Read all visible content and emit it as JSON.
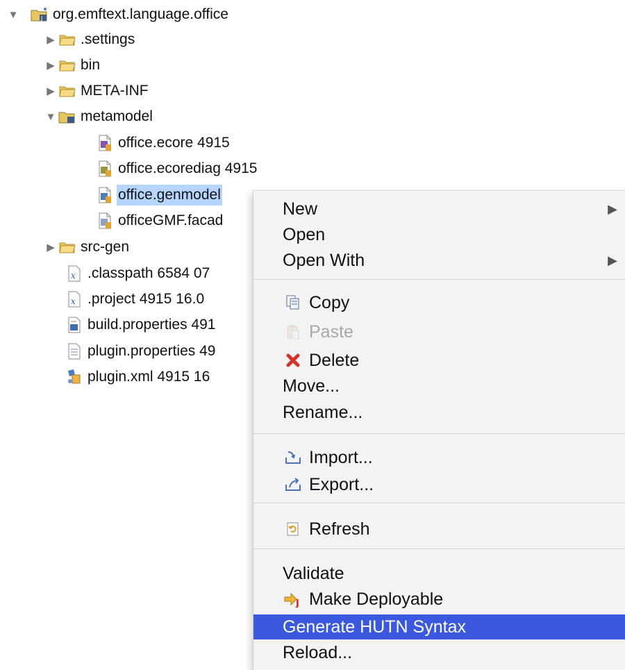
{
  "tree": {
    "root": {
      "label": "org.emftext.language.office",
      "expanded": true,
      "icon": "project-icon"
    },
    "items": [
      {
        "label": ".settings",
        "icon": "folder-icon",
        "expandable": true,
        "expanded": false
      },
      {
        "label": "bin",
        "icon": "folder-icon",
        "expandable": true,
        "expanded": false
      },
      {
        "label": "META-INF",
        "icon": "folder-icon",
        "expandable": true,
        "expanded": false
      },
      {
        "label": "metamodel",
        "icon": "source-folder-icon",
        "expandable": true,
        "expanded": true
      },
      {
        "label": "office.ecore 4915",
        "icon": "ecore-file-icon"
      },
      {
        "label": "office.ecorediag 4915",
        "icon": "ecorediag-file-icon"
      },
      {
        "label": "office.genmodel",
        "icon": "genmodel-file-icon",
        "selected": true
      },
      {
        "label": "officeGMF.facad",
        "icon": "file-icon"
      },
      {
        "label": "src-gen",
        "icon": "folder-icon",
        "expandable": true,
        "expanded": false
      },
      {
        "label": ".classpath 6584  07",
        "icon": "xml-file-icon"
      },
      {
        "label": ".project 4915  16.0",
        "icon": "xml-file-icon"
      },
      {
        "label": "build.properties 491",
        "icon": "properties-file-icon"
      },
      {
        "label": "plugin.properties 49",
        "icon": "text-file-icon"
      },
      {
        "label": "plugin.xml 4915  16",
        "icon": "plugin-xml-icon"
      }
    ]
  },
  "context_menu": {
    "items": [
      {
        "label": "New",
        "submenu": true
      },
      {
        "label": "Open"
      },
      {
        "label": "Open With",
        "submenu": true
      },
      {
        "separator": true
      },
      {
        "label": "Copy",
        "icon": "copy-icon"
      },
      {
        "label": "Paste",
        "icon": "paste-icon",
        "disabled": true
      },
      {
        "label": "Delete",
        "icon": "delete-icon"
      },
      {
        "label": "Move..."
      },
      {
        "label": "Rename..."
      },
      {
        "separator": true
      },
      {
        "label": "Import...",
        "icon": "import-icon"
      },
      {
        "label": "Export...",
        "icon": "export-icon"
      },
      {
        "separator": true
      },
      {
        "label": "Refresh",
        "icon": "refresh-icon"
      },
      {
        "separator": true
      },
      {
        "label": "Validate"
      },
      {
        "label": "Make Deployable",
        "icon": "deploy-icon"
      },
      {
        "label": "Generate HUTN Syntax",
        "highlighted": true
      },
      {
        "label": "Reload..."
      }
    ],
    "submenu_arrow": "▶"
  },
  "colors": {
    "selection": "#b5d5ff",
    "menu_highlight": "#3b59e0",
    "menu_background": "#f3f3f3",
    "folder": "#e8c45a",
    "delete": "#d9302c"
  }
}
